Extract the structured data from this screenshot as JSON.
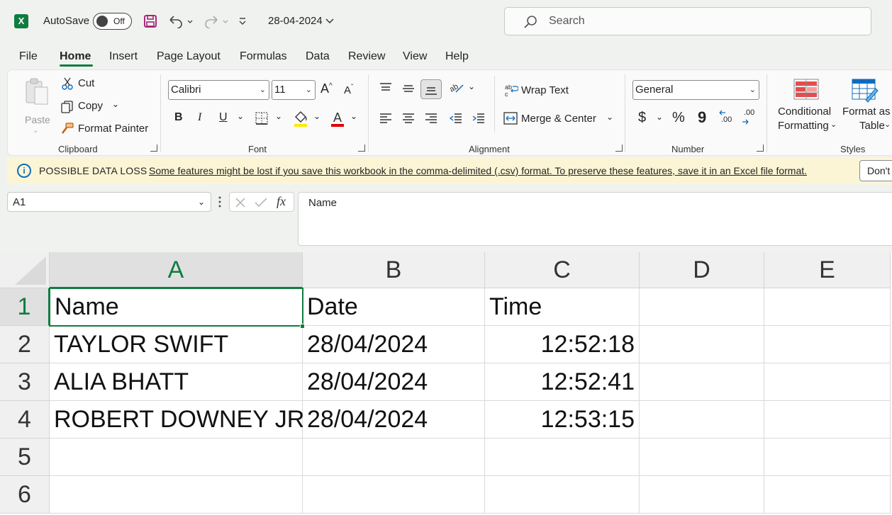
{
  "titlebar": {
    "autosave_label": "AutoSave",
    "autosave_state": "Off",
    "filename": "28-04-2024",
    "search_placeholder": "Search"
  },
  "menu": {
    "tabs": [
      {
        "label": "File"
      },
      {
        "label": "Home"
      },
      {
        "label": "Insert"
      },
      {
        "label": "Page Layout"
      },
      {
        "label": "Formulas"
      },
      {
        "label": "Data"
      },
      {
        "label": "Review"
      },
      {
        "label": "View"
      },
      {
        "label": "Help"
      }
    ],
    "active": "Home"
  },
  "ribbon": {
    "clipboard": {
      "label": "Clipboard",
      "paste": "Paste",
      "cut": "Cut",
      "copy": "Copy",
      "format_painter": "Format Painter"
    },
    "font": {
      "label": "Font",
      "font_name": "Calibri",
      "font_size": "11",
      "bold": "B",
      "italic": "I",
      "underline": "U"
    },
    "alignment": {
      "label": "Alignment",
      "wrap_text": "Wrap Text",
      "merge_center": "Merge & Center"
    },
    "number": {
      "label": "Number",
      "format": "General",
      "currency": "$",
      "percent": "%",
      "comma": "9",
      "inc_decimal": ".00",
      "dec_decimal": ".00"
    },
    "styles": {
      "label": "Styles",
      "conditional_line1": "Conditional",
      "conditional_line2": "Formatting",
      "format_table_line1": "Format as",
      "format_table_line2": "Table"
    }
  },
  "warning": {
    "title": "POSSIBLE DATA LOSS",
    "message": "Some features might be lost if you save this workbook in the comma-delimited (.csv) format. To preserve these features, save it in an Excel file format.",
    "button": "Don't"
  },
  "formula_bar": {
    "name_box": "A1",
    "fx": "fx",
    "content": "Name"
  },
  "sheet": {
    "columns": [
      "A",
      "B",
      "C",
      "D",
      "E"
    ],
    "rows": [
      "1",
      "2",
      "3",
      "4",
      "5",
      "6"
    ],
    "cells": [
      [
        "Name",
        "Date",
        "Time",
        "",
        ""
      ],
      [
        "TAYLOR SWIFT",
        "28/04/2024",
        "12:52:18",
        "",
        ""
      ],
      [
        "ALIA BHATT",
        "28/04/2024",
        "12:52:41",
        "",
        ""
      ],
      [
        "ROBERT DOWNEY JR.",
        "28/04/2024",
        "12:53:15",
        "",
        ""
      ],
      [
        "",
        "",
        "",
        "",
        ""
      ],
      [
        "",
        "",
        "",
        "",
        ""
      ]
    ],
    "active_cell": "A1"
  },
  "colors": {
    "excel_green": "#107c41",
    "warning_bg": "#fcf5d5",
    "info_blue": "#0f6cbd"
  }
}
